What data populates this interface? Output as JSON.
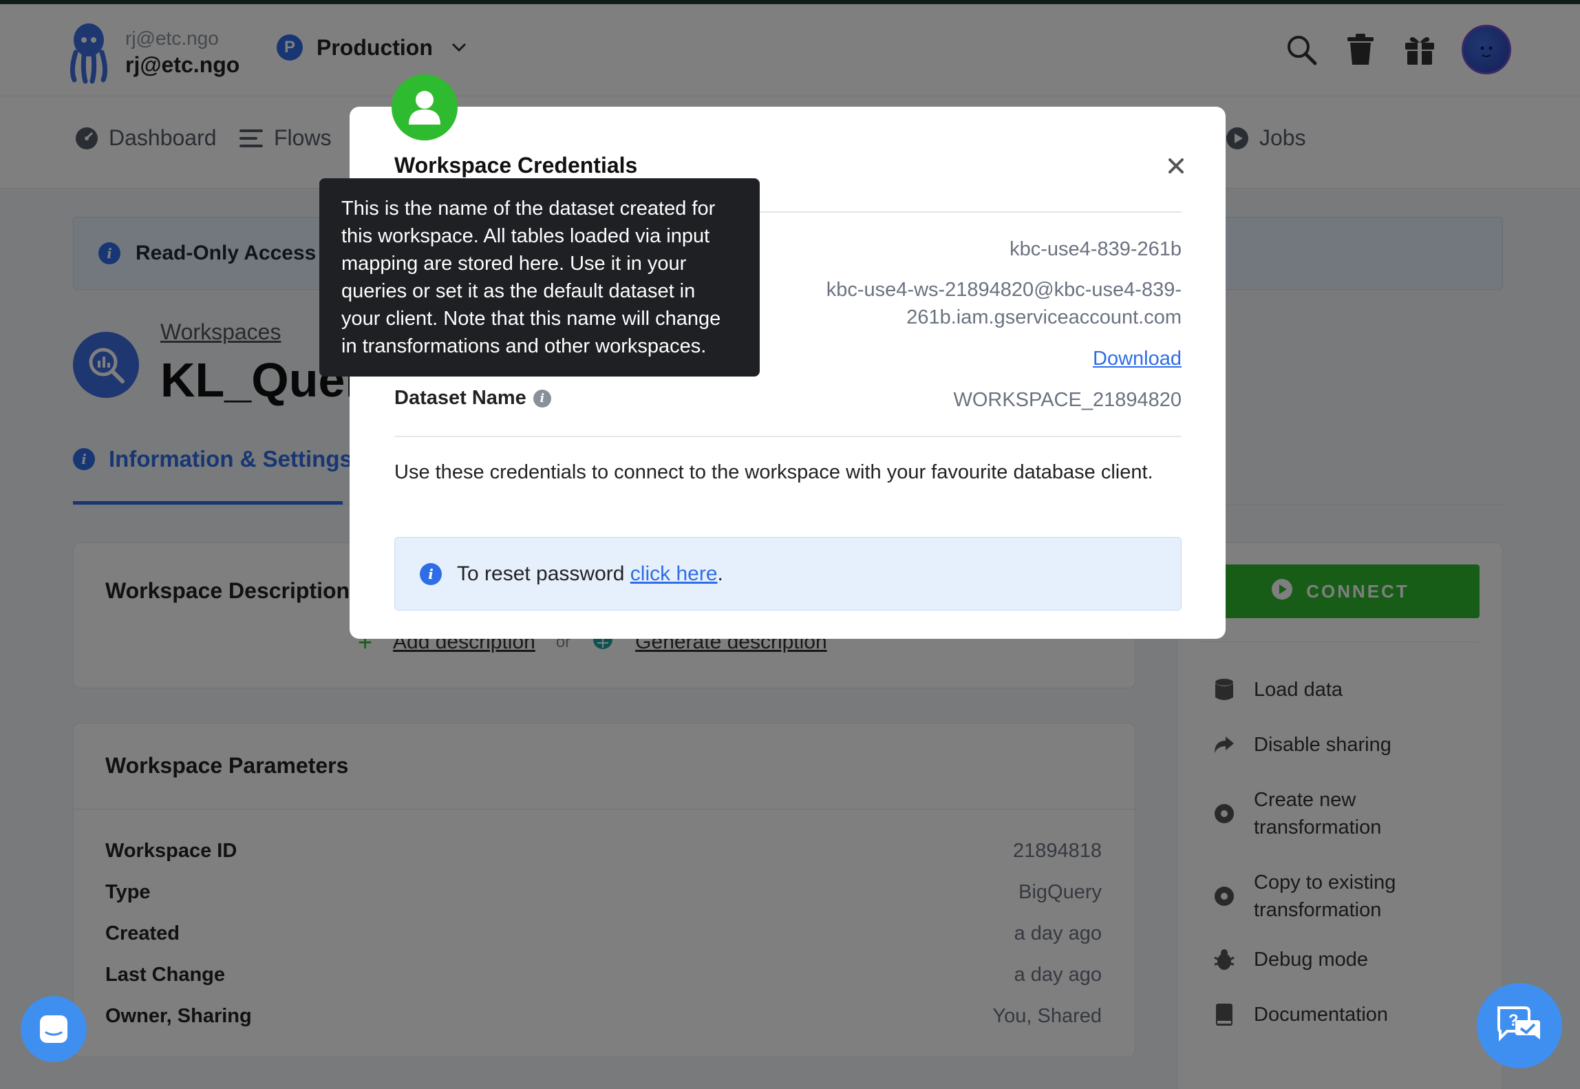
{
  "header": {
    "user_email_small": "rj@etc.ngo",
    "user_email": "rj@etc.ngo",
    "project_badge": "P",
    "project_name": "Production",
    "icons": [
      "search-icon",
      "trash-icon",
      "gift-icon"
    ]
  },
  "nav": {
    "items": [
      {
        "label": "Dashboard",
        "icon": "dashboard-icon"
      },
      {
        "label": "Flows",
        "icon": "flows-icon"
      },
      {
        "label": "Jobs",
        "icon": "play-circle-icon"
      }
    ]
  },
  "banner": {
    "text": "Read-Only Access t"
  },
  "page": {
    "breadcrumb": "Workspaces",
    "title": "KL_Query",
    "active_tab": "Information & Settings"
  },
  "description_card": {
    "title": "Workspace Description",
    "add_label": "Add description",
    "or_label": "or",
    "generate_label": "Generate description"
  },
  "params_card": {
    "title": "Workspace Parameters",
    "rows": [
      {
        "key": "Workspace ID",
        "value": "21894818"
      },
      {
        "key": "Type",
        "value": "BigQuery"
      },
      {
        "key": "Created",
        "value": "a day ago"
      },
      {
        "key": "Last Change",
        "value": "a day ago"
      },
      {
        "key": "Owner, Sharing",
        "value": "You, Shared"
      }
    ]
  },
  "sidebar": {
    "connect_label": "CONNECT",
    "items": [
      {
        "label": "Load data",
        "icon": "database-icon"
      },
      {
        "label": "Disable sharing",
        "icon": "share-icon"
      },
      {
        "label": "Create new transformation",
        "icon": "gear-icon"
      },
      {
        "label": "Copy to existing transformation",
        "icon": "gear-icon"
      },
      {
        "label": "Debug mode",
        "icon": "bug-icon"
      },
      {
        "label": "Documentation",
        "icon": "book-icon"
      }
    ],
    "create_line1": "Create new",
    "create_line2": "transformation",
    "copy_line1": "Copy to existing",
    "copy_line2": "transformation"
  },
  "modal": {
    "title": "Workspace Credentials",
    "project_value": "kbc-use4-839-261b",
    "service_account_line1": "kbc-use4-ws-21894820@kbc-use4-839-",
    "service_account_line2": "261b.iam.gserviceaccount.com",
    "download_label": "Download",
    "dataset_key": "Dataset Name",
    "dataset_value": "WORKSPACE_21894820",
    "help_text": "Use these credentials to connect to the workspace with your favourite database client.",
    "reset_prefix": "To reset password",
    "reset_link": "click here",
    "reset_suffix": "."
  },
  "tooltip": {
    "text": "This is the name of the dataset created for this workspace. All tables loaded via input mapping are stored here. Use it in your queries or set it as the default dataset in your client. Note that this name will change in transformations and other workspaces."
  },
  "colors": {
    "accent_blue": "#2e6de6",
    "connect_green": "#2fbb2f",
    "tooltip_bg": "#1f2023"
  }
}
